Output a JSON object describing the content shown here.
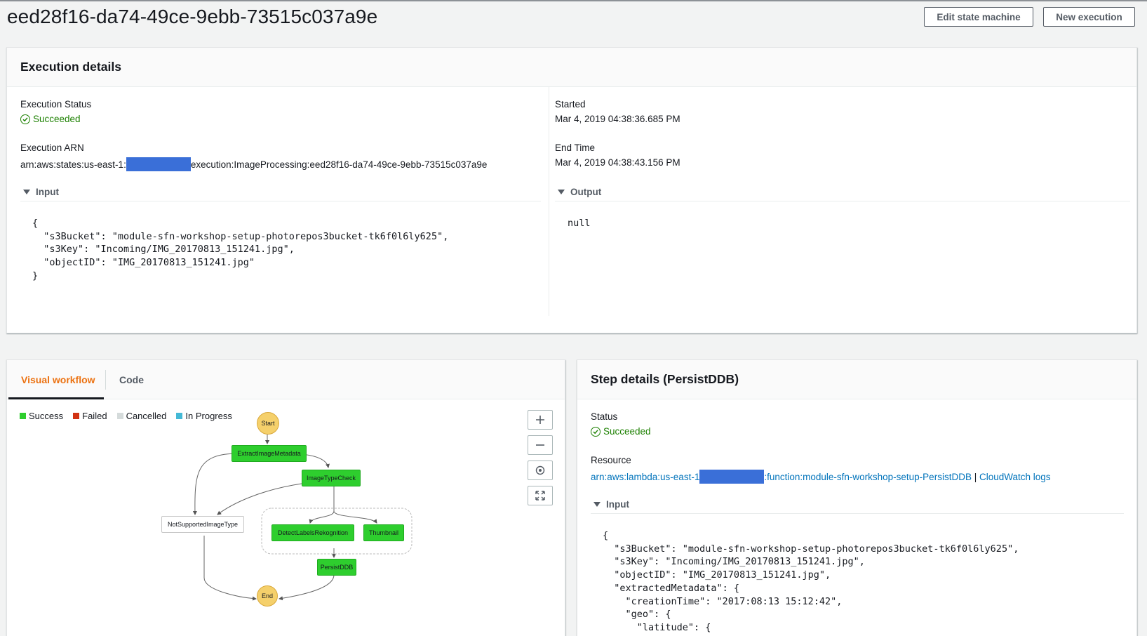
{
  "header": {
    "title": "eed28f16-da74-49ce-9ebb-73515c037a9e",
    "edit_button": "Edit state machine",
    "new_button": "New execution"
  },
  "execution_details": {
    "heading": "Execution details",
    "status_label": "Execution Status",
    "status_value": "Succeeded",
    "arn_label": "Execution ARN",
    "arn_prefix": "arn:aws:states:us-east-1:",
    "arn_suffix": "execution:ImageProcessing:eed28f16-da74-49ce-9ebb-73515c037a9e",
    "started_label": "Started",
    "started_value": "Mar 4, 2019 04:38:36.685 PM",
    "end_label": "End Time",
    "end_value": "Mar 4, 2019 04:38:43.156 PM",
    "input_label": "Input",
    "input_json": "{\n  \"s3Bucket\": \"module-sfn-workshop-setup-photorepos3bucket-tk6f0l6ly625\",\n  \"s3Key\": \"Incoming/IMG_20170813_151241.jpg\",\n  \"objectID\": \"IMG_20170813_151241.jpg\"\n}",
    "output_label": "Output",
    "output_json": "null"
  },
  "workflow": {
    "tabs": [
      "Visual workflow",
      "Code"
    ],
    "legend": [
      {
        "label": "Success",
        "color": "#2ece2e"
      },
      {
        "label": "Failed",
        "color": "#d13212"
      },
      {
        "label": "Cancelled",
        "color": "#d5dbdb"
      },
      {
        "label": "In Progress",
        "color": "#44b9d6"
      }
    ],
    "zoom_icons": [
      "plus-icon",
      "minus-icon",
      "center-icon",
      "fit-icon"
    ],
    "nodes": {
      "start": "Start",
      "extract": "ExtractImageMetadata",
      "typecheck": "ImageTypeCheck",
      "notsupported": "NotSupportedImageType",
      "detect": "DetectLabelsRekognition",
      "thumbnail": "Thumbnail",
      "persist": "PersistDDB",
      "end": "End"
    }
  },
  "step_details": {
    "heading": "Step details (PersistDDB)",
    "status_label": "Status",
    "status_value": "Succeeded",
    "resource_label": "Resource",
    "resource_prefix": "arn:aws:lambda:us-east-1",
    "resource_suffix": ":function:module-sfn-workshop-setup-PersistDDB",
    "resource_sep": "|",
    "cloudwatch_link": "CloudWatch logs",
    "input_label": "Input",
    "input_json": "{\n  \"s3Bucket\": \"module-sfn-workshop-setup-photorepos3bucket-tk6f0l6ly625\",\n  \"s3Key\": \"Incoming/IMG_20170813_151241.jpg\",\n  \"objectID\": \"IMG_20170813_151241.jpg\",\n  \"extractedMetadata\": {\n    \"creationTime\": \"2017:08:13 15:12:42\",\n    \"geo\": {\n      \"latitude\": {"
  }
}
